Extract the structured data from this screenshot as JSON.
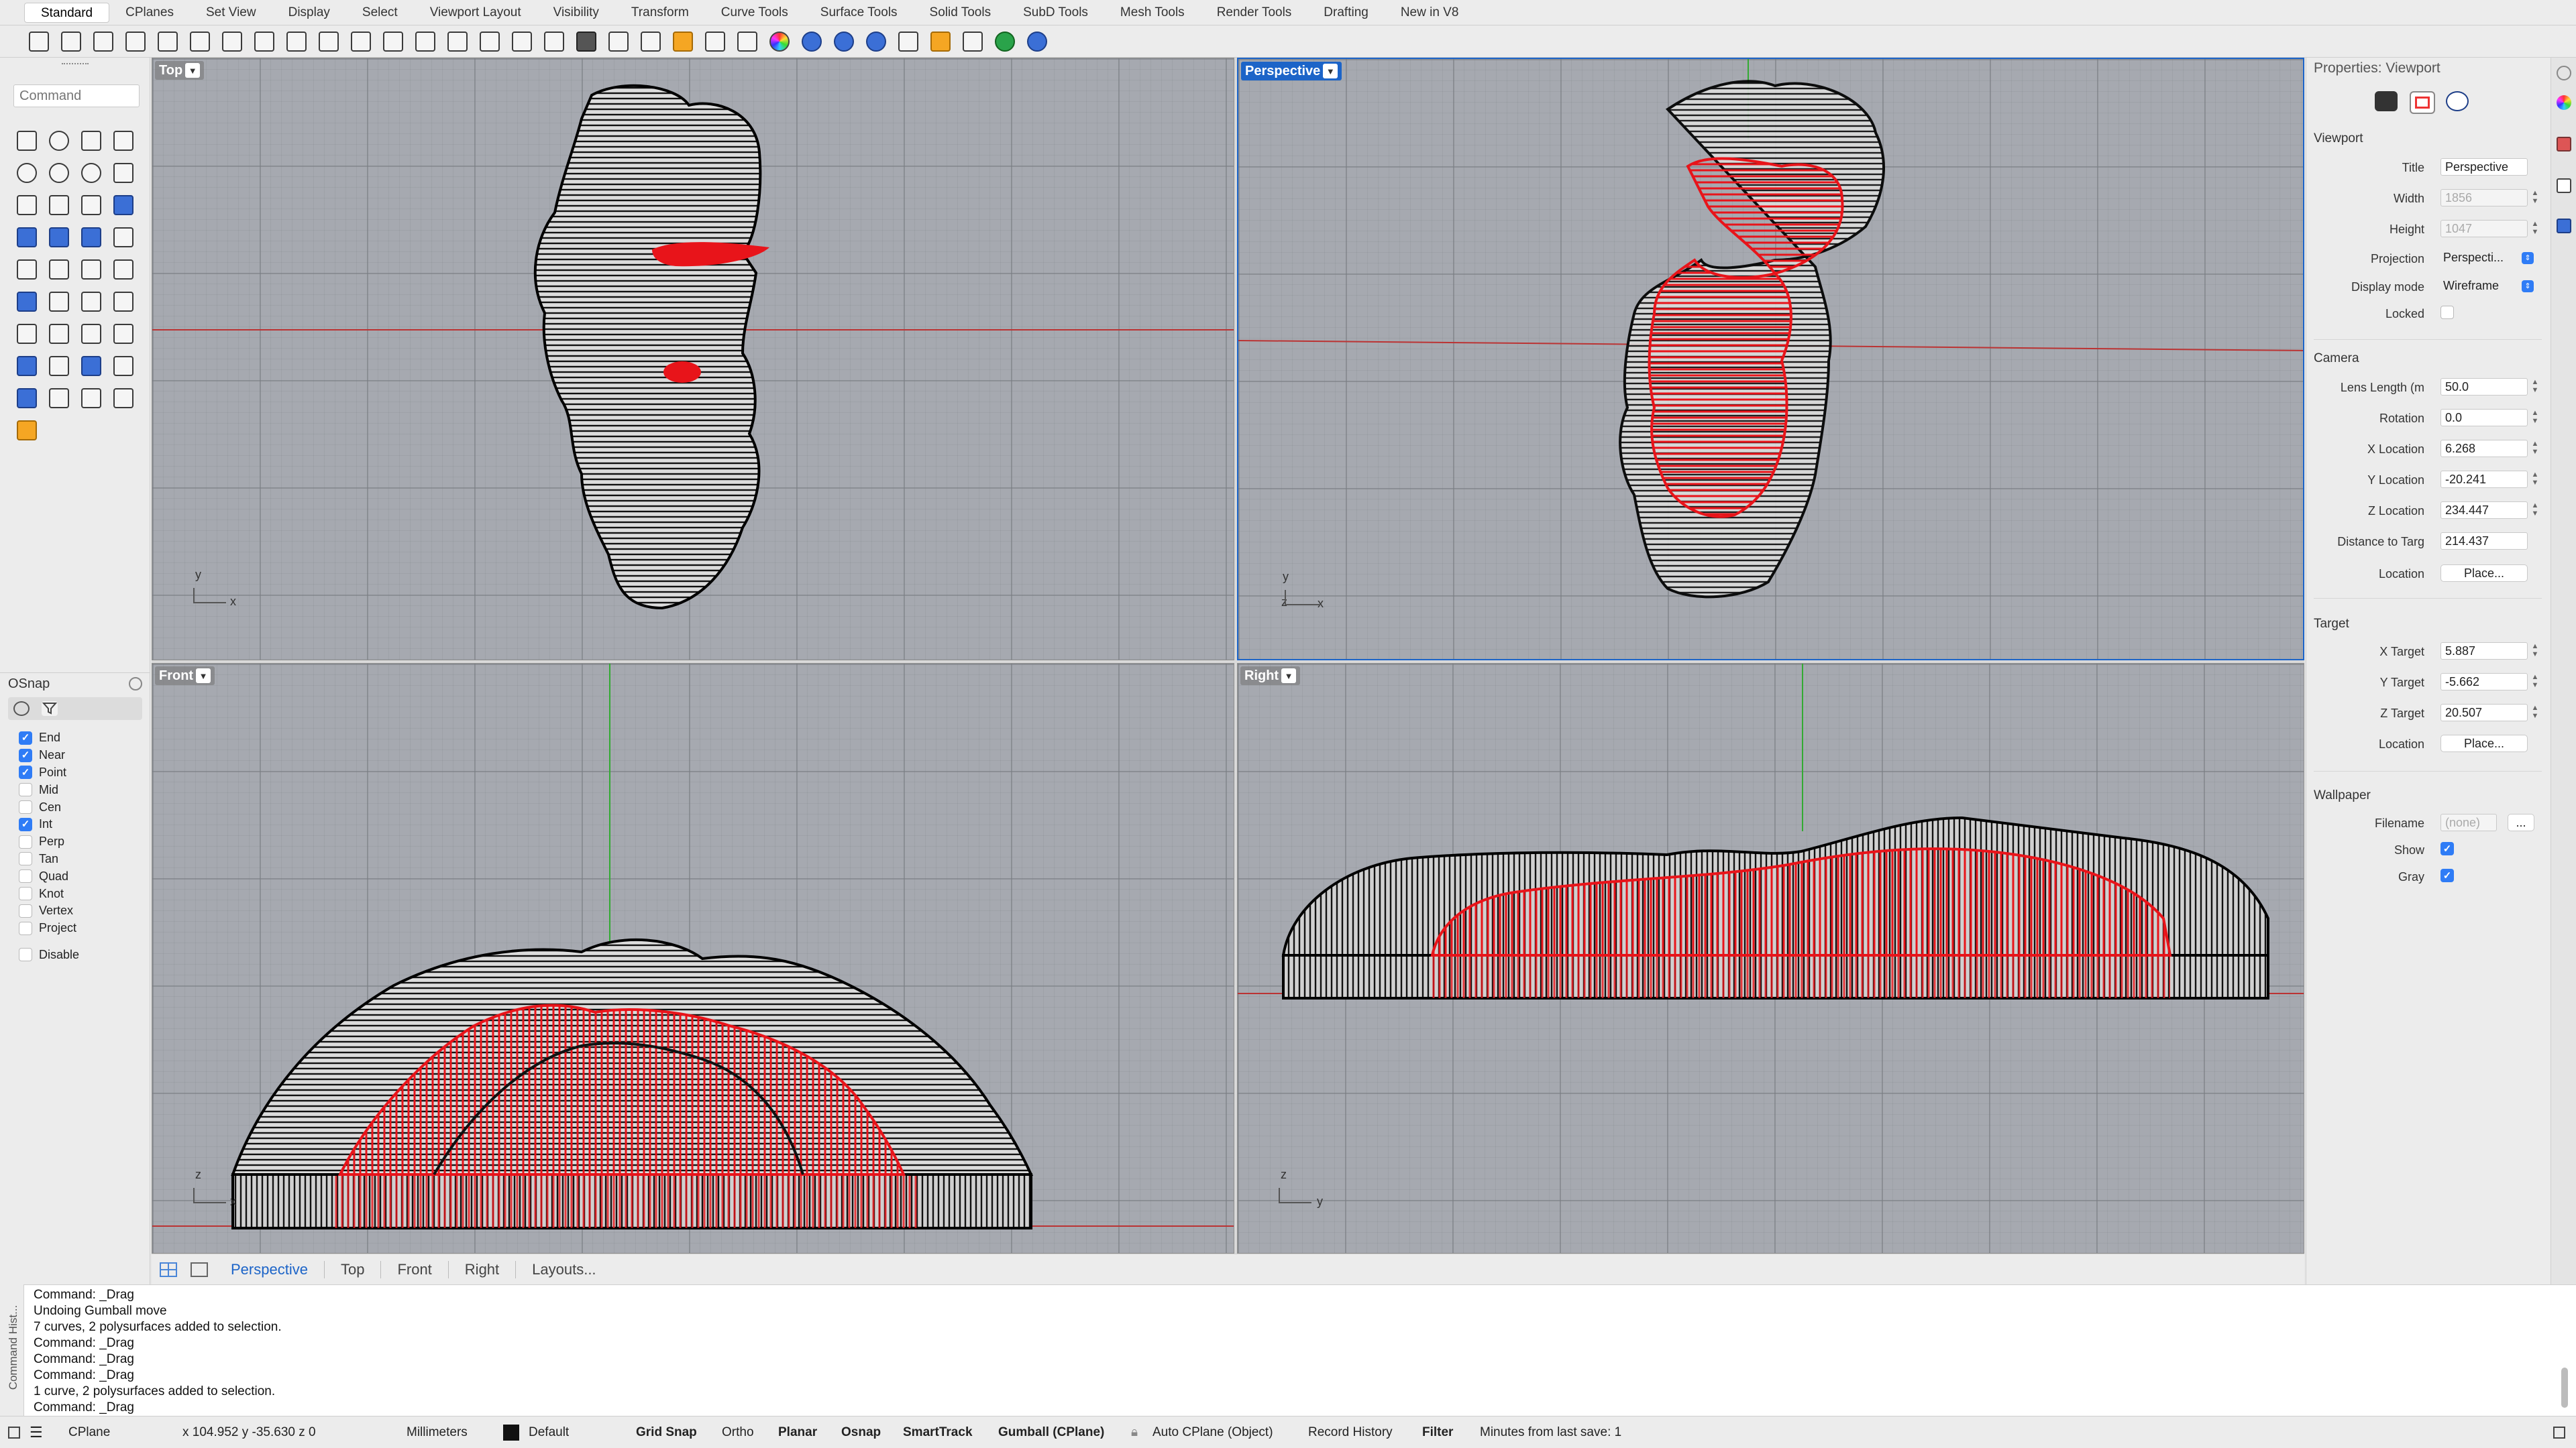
{
  "tabs": [
    "Standard",
    "CPlanes",
    "Set View",
    "Display",
    "Select",
    "Viewport Layout",
    "Visibility",
    "Transform",
    "Curve Tools",
    "Surface Tools",
    "Solid Tools",
    "SubD Tools",
    "Mesh Tools",
    "Render Tools",
    "Drafting",
    "New in V8"
  ],
  "active_tab": "Standard",
  "toolbar_icons": [
    "new-file-icon",
    "open-folder-icon",
    "save-icon",
    "print-icon",
    "import-icon",
    "cut-icon",
    "copy-icon",
    "paste-icon",
    "undo-icon",
    "pan-hand-icon",
    "rotate-view-icon",
    "zoom-icon",
    "zoom-window-icon",
    "zoom-extents-icon",
    "zoom-selected-icon",
    "rotate-icon",
    "grid-icon",
    "car-icon",
    "shape-icon",
    "layer-icon",
    "light-bulb-icon",
    "lock-icon",
    "material-icon",
    "color-wheel-icon",
    "sphere-wire-icon",
    "sphere-shaded-icon",
    "sphere-render-icon",
    "point-select-icon",
    "gear-tools-icon",
    "gumball-icon",
    "globe-icon",
    "help-icon"
  ],
  "command_placeholder": "Command",
  "osnap": {
    "title": "OSnap",
    "items": [
      {
        "label": "End",
        "checked": true
      },
      {
        "label": "Near",
        "checked": true
      },
      {
        "label": "Point",
        "checked": true
      },
      {
        "label": "Mid",
        "checked": false
      },
      {
        "label": "Cen",
        "checked": false
      },
      {
        "label": "Int",
        "checked": true
      },
      {
        "label": "Perp",
        "checked": false
      },
      {
        "label": "Tan",
        "checked": false
      },
      {
        "label": "Quad",
        "checked": false
      },
      {
        "label": "Knot",
        "checked": false
      },
      {
        "label": "Vertex",
        "checked": false
      },
      {
        "label": "Project",
        "checked": false
      }
    ],
    "disable": {
      "label": "Disable",
      "checked": false
    }
  },
  "viewports": {
    "top": {
      "title": "Top",
      "axis1": "y",
      "axis2": "x"
    },
    "perspective": {
      "title": "Perspective",
      "axis1": "y",
      "axis2": "z",
      "axis3": "x"
    },
    "front": {
      "title": "Front",
      "axis1": "z",
      "axis2": "x"
    },
    "right": {
      "title": "Right",
      "axis1": "z",
      "axis2": "y"
    }
  },
  "viewport_tabs": [
    "Perspective",
    "Top",
    "Front",
    "Right",
    "Layouts..."
  ],
  "properties": {
    "title": "Properties: Viewport",
    "viewport_section": "Viewport",
    "title_label": "Title",
    "title_value": "Perspective",
    "width_label": "Width",
    "width_value": "1856",
    "height_label": "Height",
    "height_value": "1047",
    "projection_label": "Projection",
    "projection_value": "Perspecti...",
    "display_label": "Display mode",
    "display_value": "Wireframe",
    "locked_label": "Locked",
    "camera_section": "Camera",
    "lens_label": "Lens Length (m",
    "lens_value": "50.0",
    "rotation_label": "Rotation",
    "rotation_value": "0.0",
    "xloc_label": "X Location",
    "xloc_value": "6.268",
    "yloc_label": "Y Location",
    "yloc_value": "-20.241",
    "zloc_label": "Z Location",
    "zloc_value": "234.447",
    "dist_label": "Distance to Targ",
    "dist_value": "214.437",
    "loc_label": "Location",
    "place_label": "Place...",
    "target_section": "Target",
    "xt_label": "X Target",
    "xt_value": "5.887",
    "yt_label": "Y Target",
    "yt_value": "-5.662",
    "zt_label": "Z Target",
    "zt_value": "20.507",
    "tloc_label": "Location",
    "tplace_label": "Place...",
    "wallpaper_section": "Wallpaper",
    "filename_label": "Filename",
    "filename_value": "(none)",
    "browse_label": "...",
    "show_label": "Show",
    "gray_label": "Gray"
  },
  "command_history_label": "Command Hist...",
  "command_history": [
    "Command: _Drag",
    "Undoing Gumball move",
    "7 curves, 2 polysurfaces added to selection.",
    "Command: _Drag",
    "Command: _Drag",
    "Command: _Drag",
    "1 curve, 2 polysurfaces added to selection.",
    "Command: _Drag"
  ],
  "status": {
    "cplane": "CPlane",
    "coords": "x 104.952   y -35.630   z 0",
    "units": "Millimeters",
    "layer": "Default",
    "grid_snap": "Grid Snap",
    "ortho": "Ortho",
    "planar": "Planar",
    "osnap": "Osnap",
    "smarttrack": "SmartTrack",
    "gumball": "Gumball (CPlane)",
    "auto_cplane": "Auto CPlane (Object)",
    "record_history": "Record History",
    "filter": "Filter",
    "save_info": "Minutes from last save: 1"
  },
  "colors": {
    "accent": "#1c64c8",
    "checkbox": "#2f7cf6",
    "wire": "#1a1a1a",
    "highlight": "#e8141a",
    "viewport_bg": "#a6a9b0"
  }
}
